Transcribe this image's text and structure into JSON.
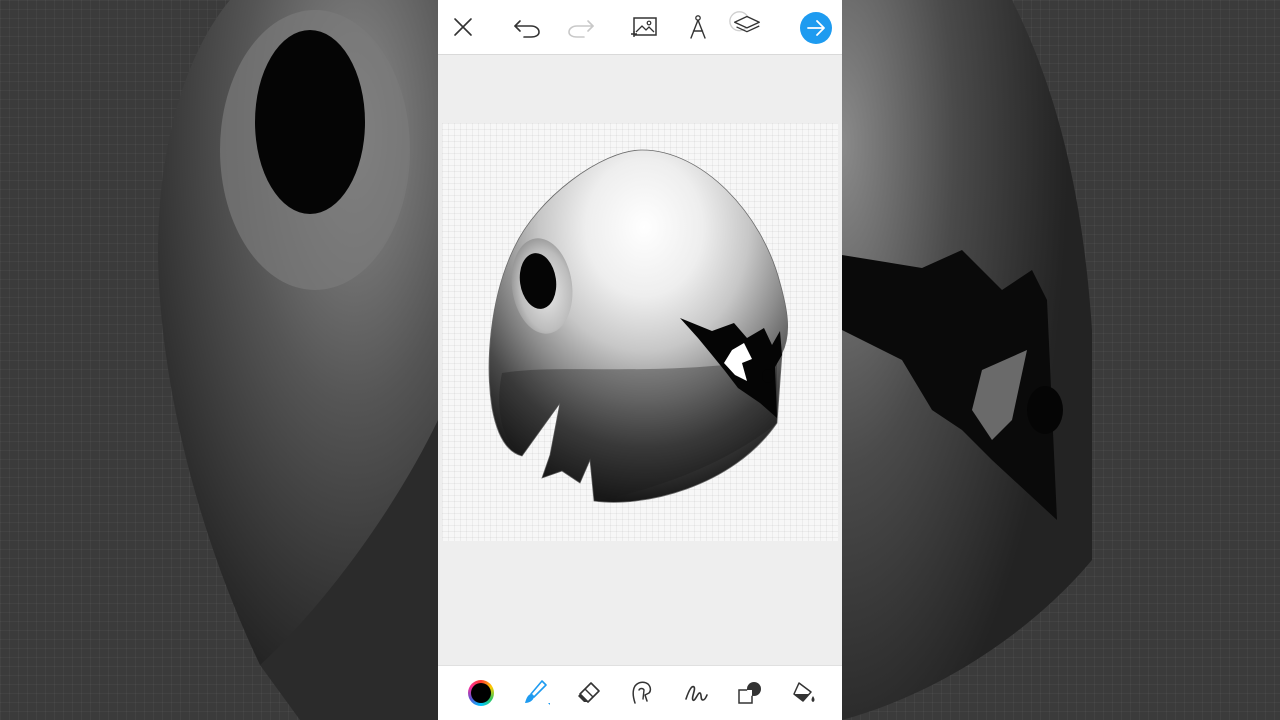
{
  "app": {
    "accent": "#1e9bf0",
    "current_color": "#000000"
  },
  "topbar": {
    "close": {
      "icon": "close-icon"
    },
    "undo": {
      "icon": "undo-icon"
    },
    "redo": {
      "icon": "redo-icon",
      "enabled": false
    },
    "add_image": {
      "icon": "add-image-icon"
    },
    "ruler": {
      "icon": "compass-ruler-icon"
    },
    "layers": {
      "icon": "layers-icon"
    },
    "done": {
      "icon": "arrow-right-icon"
    }
  },
  "tools": [
    {
      "id": "color",
      "icon": "color-picker-swatch",
      "active": false
    },
    {
      "id": "brush",
      "icon": "brush-icon",
      "active": true
    },
    {
      "id": "eraser",
      "icon": "eraser-icon",
      "active": false
    },
    {
      "id": "smudge",
      "icon": "smudge-finger-icon",
      "active": false
    },
    {
      "id": "lasso",
      "icon": "lasso-stroke-icon",
      "active": false
    },
    {
      "id": "shapes",
      "icon": "shapes-icon",
      "active": false
    },
    {
      "id": "fill",
      "icon": "fill-bucket-icon",
      "active": false
    }
  ]
}
